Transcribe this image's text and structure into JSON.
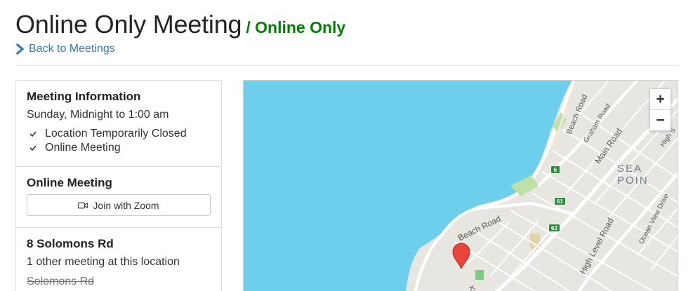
{
  "colors": {
    "accent_link": "#337ab7",
    "online_badge": "#008000",
    "sea": "#6ecfed",
    "land": "#e8e6e1",
    "road": "#ffffff",
    "park": "#bfe0a8",
    "pin": "#e8453c",
    "route_shield": "#2b8a3e"
  },
  "header": {
    "title": "Online Only Meeting",
    "type_badge": "/ Online Only",
    "back_link": "Back to Meetings",
    "back_icon": "chevron-right-icon"
  },
  "meeting_info": {
    "heading": "Meeting Information",
    "time": "Sunday, Midnight to 1:00 am",
    "types": [
      {
        "label": "Location Temporarily Closed",
        "icon": "check-icon"
      },
      {
        "label": "Online Meeting",
        "icon": "check-icon"
      }
    ]
  },
  "online_meeting": {
    "heading": "Online Meeting",
    "button_label": "Join with Zoom",
    "button_icon": "video-camera-icon"
  },
  "location": {
    "heading": "8 Solomons Rd",
    "other_meetings": "1 other meeting at this location",
    "address_struck": "Solomons Rd"
  },
  "map": {
    "zoom_in": "+",
    "zoom_out": "−",
    "suburb": "SEA POIN",
    "streets": {
      "beach_road_top": "Beach Road",
      "graham_road": "Graham Road",
      "main_road": "Main Road",
      "high_street": "High S",
      "beach_road_bottom": "Beach Road",
      "high_level_road": "High Level Road",
      "ocean_view_drive": "Ocean View Drive",
      "king": "King"
    },
    "route_shields": [
      "6",
      "61",
      "62"
    ],
    "marker_icon": "map-pin-icon"
  }
}
